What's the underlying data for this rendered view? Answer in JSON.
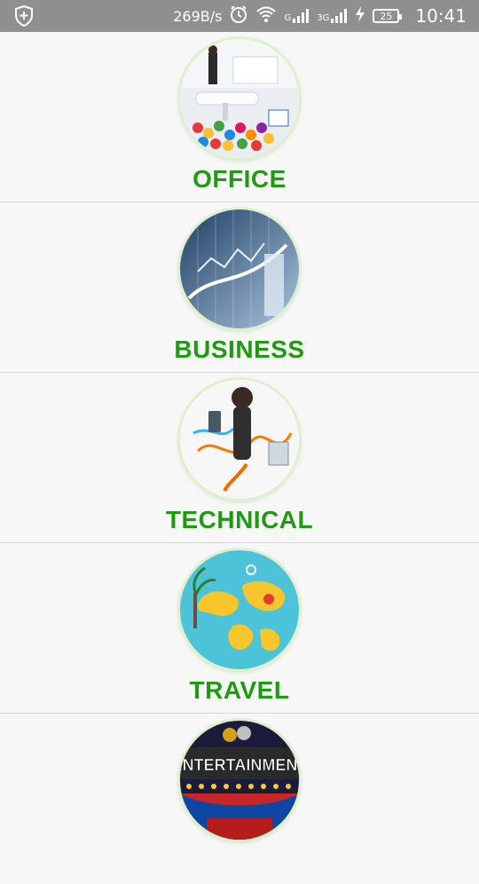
{
  "status_bar": {
    "net_speed": "269B/s",
    "signal_1": "G",
    "signal_2": "3G",
    "battery": "25",
    "time": "10:41"
  },
  "categories": [
    {
      "label": "OFFICE",
      "icon": "office-image"
    },
    {
      "label": "BUSINESS",
      "icon": "business-chart-image"
    },
    {
      "label": "TECHNICAL",
      "icon": "technical-gadgets-image"
    },
    {
      "label": "TRAVEL",
      "icon": "travel-world-map-image"
    },
    {
      "label": "ENTERTAINMENT",
      "icon": "entertainment-marquee-image"
    }
  ],
  "colors": {
    "label_green": "#1f9a12",
    "statusbar_gray": "#8f8f8f",
    "divider": "#d6d6d6"
  }
}
